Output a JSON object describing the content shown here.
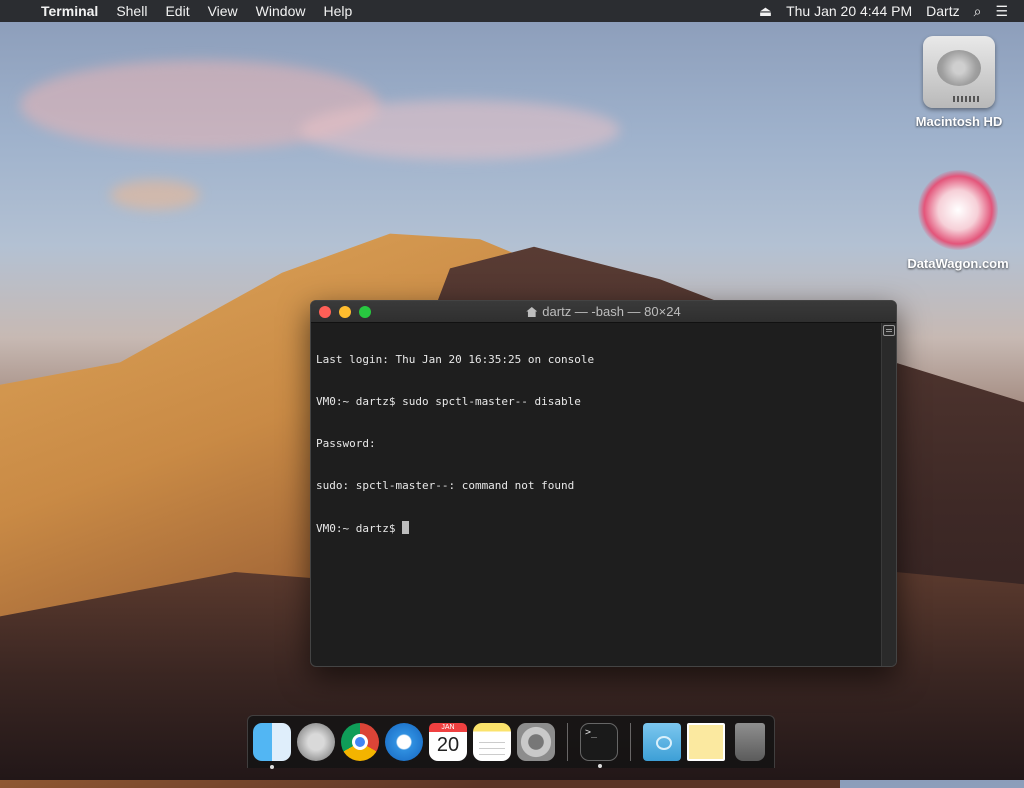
{
  "menubar": {
    "apple_glyph": "",
    "app_name": "Terminal",
    "menus": [
      "Shell",
      "Edit",
      "View",
      "Window",
      "Help"
    ],
    "eject_glyph": "⏏",
    "datetime": "Thu Jan 20  4:44 PM",
    "user": "Dartz",
    "search_glyph": "⌕",
    "list_glyph": "☰"
  },
  "desktop": {
    "icons": [
      {
        "label": "Macintosh HD"
      },
      {
        "label": "DataWagon.com"
      }
    ]
  },
  "terminal": {
    "title": "dartz — -bash — 80×24",
    "lines": [
      "Last login: Thu Jan 20 16:35:25 on console",
      "VM0:~ dartz$ sudo spctl-master-- disable",
      "Password:",
      "sudo: spctl-master--: command not found",
      "VM0:~ dartz$ "
    ]
  },
  "dock": {
    "calendar_month": "JAN",
    "calendar_day": "20",
    "terminal_prompt": ">_"
  }
}
